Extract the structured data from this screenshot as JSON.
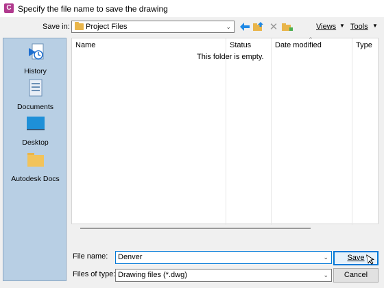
{
  "window": {
    "title": "Specify the file name to save the drawing",
    "app_icon_glyph": "C"
  },
  "toolbar": {
    "save_in_label": "Save in:",
    "save_in_value": "Project Files",
    "views_label": "Views",
    "tools_label": "Tools"
  },
  "places": [
    {
      "label": "History",
      "icon": "history-icon"
    },
    {
      "label": "Documents",
      "icon": "documents-icon"
    },
    {
      "label": "Desktop",
      "icon": "desktop-icon"
    },
    {
      "label": "Autodesk Docs",
      "icon": "folder-icon"
    }
  ],
  "filelist": {
    "columns": [
      "Name",
      "Status",
      "Date modified",
      "Type"
    ],
    "empty_message": "This folder is empty."
  },
  "form": {
    "file_name_label": "File name:",
    "file_name_value": "Denver",
    "file_type_label": "Files of type:",
    "file_type_value": "Drawing files (*.dwg)",
    "save_label": "Save",
    "cancel_label": "Cancel"
  },
  "colors": {
    "accent": "#0078d7",
    "places_bg": "#b8cfe4",
    "folder": "#e9b54a"
  }
}
